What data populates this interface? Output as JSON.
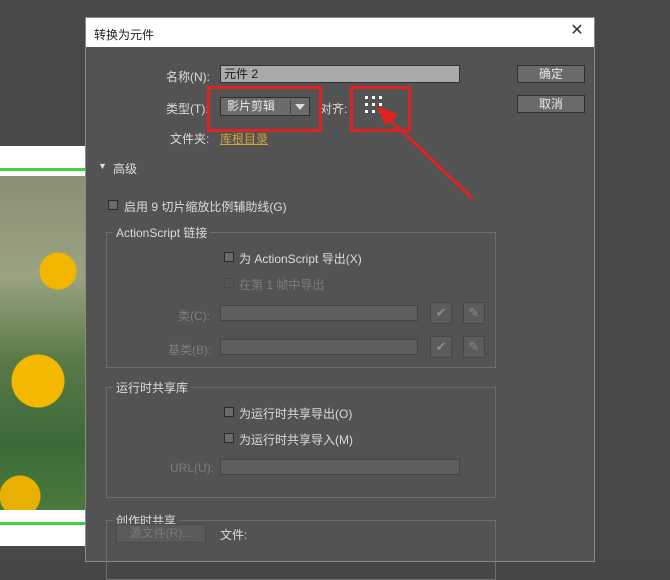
{
  "dialog": {
    "title": "转换为元件",
    "close_glyph": "✕"
  },
  "form": {
    "name_label": "名称(N):",
    "name_value": "元件 2",
    "type_label": "类型(T):",
    "type_value": "影片剪辑",
    "align_label": "对齐:",
    "folder_label": "文件夹:",
    "folder_value": "库根目录"
  },
  "buttons": {
    "ok": "确定",
    "cancel": "取消"
  },
  "advanced": {
    "toggle_label": "高级",
    "enable_9slice": "启用 9 切片缩放比例辅助线(G)"
  },
  "actionscript": {
    "group_title": "ActionScript 链接",
    "export_as": "为 ActionScript 导出(X)",
    "export_frame1": "在第 1 帧中导出",
    "class_label": "类(C):",
    "base_class_label": "基类(B):"
  },
  "runtime_share": {
    "group_title": "运行时共享库",
    "export_runtime": "为运行时共享导出(O)",
    "import_runtime": "为运行时共享导入(M)",
    "url_label": "URL(U):"
  },
  "authortime_share": {
    "group_title": "创作时共享",
    "source_file_button": "源文件(R)...",
    "file_label": "文件:"
  },
  "icons": {
    "check": "✔",
    "pencil": "✎",
    "triangle": "▼",
    "align_grid": "registration-grid-icon"
  },
  "colors": {
    "annotation_red": "#e02222",
    "dialog_bg": "#535353",
    "link_gold": "#d2a23a"
  }
}
